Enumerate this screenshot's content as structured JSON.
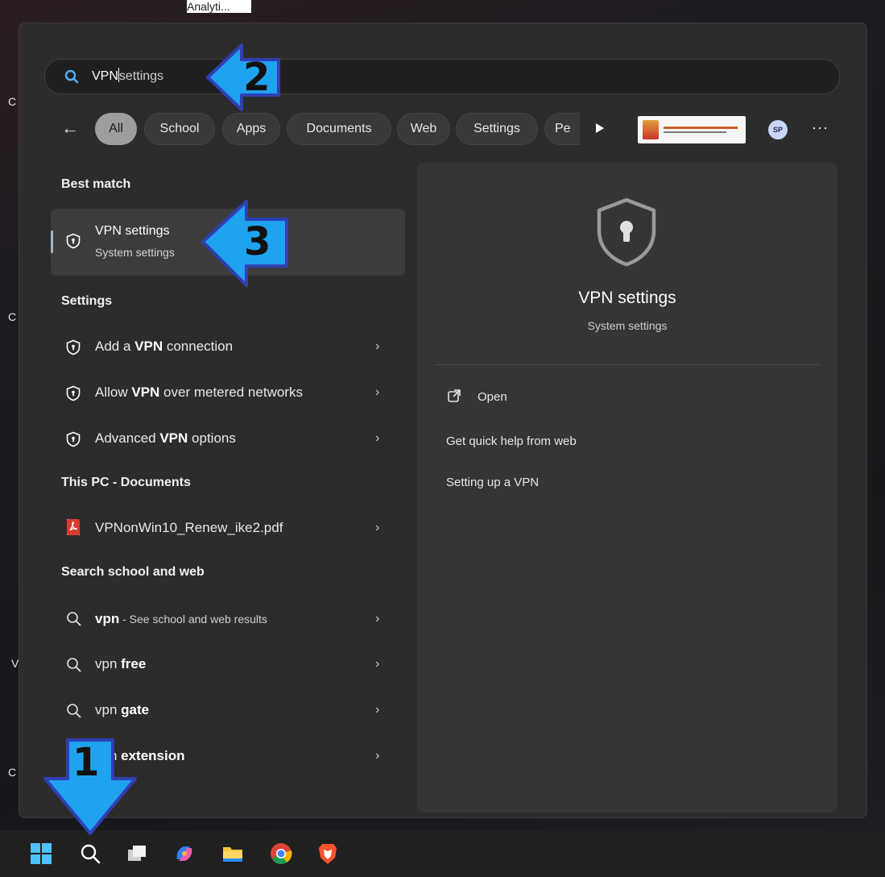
{
  "desktop": {
    "top_label": "Analyti...",
    "side_labels": [
      "C",
      "C",
      "V",
      "C"
    ]
  },
  "search": {
    "query_typed": "VPN",
    "query_rest": "settings"
  },
  "filters": {
    "back": "←",
    "chips": [
      "All",
      "School",
      "Apps",
      "Documents",
      "Web",
      "Settings",
      "Pe"
    ],
    "avatar_initials": "SP",
    "more": "···"
  },
  "best_match": {
    "header": "Best match",
    "title": "VPN settings",
    "subtitle": "System settings"
  },
  "settings_section": {
    "header": "Settings",
    "items": [
      {
        "pre": "Add a ",
        "bold": "VPN",
        "post": " connection"
      },
      {
        "pre": "Allow ",
        "bold": "VPN",
        "post": " over metered networks"
      },
      {
        "pre": "Advanced ",
        "bold": "VPN",
        "post": " options"
      }
    ]
  },
  "documents_section": {
    "header": "This PC - Documents",
    "items": [
      {
        "name": "VPNonWin10_Renew_ike2.pdf"
      }
    ]
  },
  "web_section": {
    "header": "Search school and web",
    "items": [
      {
        "pre": "vpn",
        "bold": "",
        "post": " - See school and web results"
      },
      {
        "pre": "vpn ",
        "bold": "free",
        "post": ""
      },
      {
        "pre": "vpn ",
        "bold": "gate",
        "post": ""
      },
      {
        "pre": "vpn ",
        "bold": "extension",
        "post": ""
      }
    ]
  },
  "detail": {
    "title": "VPN settings",
    "subtitle": "System settings",
    "actions": [
      "Open",
      "Get quick help from web",
      "Setting up a VPN"
    ]
  },
  "callouts": [
    "1",
    "2",
    "3"
  ],
  "colors": {
    "callout_arrow": "#1fa3ee",
    "callout_border": "#2f3fb5",
    "panel_bg": "#2c2c2c",
    "detail_bg": "#353535"
  }
}
